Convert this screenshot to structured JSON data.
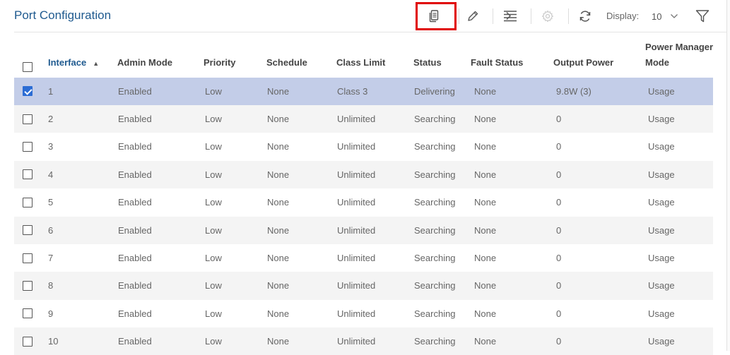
{
  "page": {
    "title": "Port Configuration"
  },
  "toolbar": {
    "display_label": "Display:",
    "display_value": "10",
    "icons": [
      "copy-icon",
      "edit-icon",
      "detail-icon",
      "settings-icon",
      "refresh-icon",
      "filter-icon"
    ],
    "highlight_color": "#e00000"
  },
  "columns": {
    "interface": "Interface",
    "admin_mode": "Admin Mode",
    "priority": "Priority",
    "schedule": "Schedule",
    "class_limit": "Class Limit",
    "status": "Status",
    "fault_status": "Fault Status",
    "output_power": "Output Power",
    "power_mgmt_line1": "Power Manager",
    "power_mgmt_line2": "Mode",
    "sort_indicator": "▲"
  },
  "rows": [
    {
      "selected": true,
      "interface": "1",
      "admin_mode": "Enabled",
      "priority": "Low",
      "schedule": "None",
      "class_limit": "Class 3",
      "status": "Delivering",
      "fault_status": "None",
      "output_power": "9.8W (3)",
      "power_mgmt": "Usage"
    },
    {
      "selected": false,
      "interface": "2",
      "admin_mode": "Enabled",
      "priority": "Low",
      "schedule": "None",
      "class_limit": "Unlimited",
      "status": "Searching",
      "fault_status": "None",
      "output_power": "0",
      "power_mgmt": "Usage"
    },
    {
      "selected": false,
      "interface": "3",
      "admin_mode": "Enabled",
      "priority": "Low",
      "schedule": "None",
      "class_limit": "Unlimited",
      "status": "Searching",
      "fault_status": "None",
      "output_power": "0",
      "power_mgmt": "Usage"
    },
    {
      "selected": false,
      "interface": "4",
      "admin_mode": "Enabled",
      "priority": "Low",
      "schedule": "None",
      "class_limit": "Unlimited",
      "status": "Searching",
      "fault_status": "None",
      "output_power": "0",
      "power_mgmt": "Usage"
    },
    {
      "selected": false,
      "interface": "5",
      "admin_mode": "Enabled",
      "priority": "Low",
      "schedule": "None",
      "class_limit": "Unlimited",
      "status": "Searching",
      "fault_status": "None",
      "output_power": "0",
      "power_mgmt": "Usage"
    },
    {
      "selected": false,
      "interface": "6",
      "admin_mode": "Enabled",
      "priority": "Low",
      "schedule": "None",
      "class_limit": "Unlimited",
      "status": "Searching",
      "fault_status": "None",
      "output_power": "0",
      "power_mgmt": "Usage"
    },
    {
      "selected": false,
      "interface": "7",
      "admin_mode": "Enabled",
      "priority": "Low",
      "schedule": "None",
      "class_limit": "Unlimited",
      "status": "Searching",
      "fault_status": "None",
      "output_power": "0",
      "power_mgmt": "Usage"
    },
    {
      "selected": false,
      "interface": "8",
      "admin_mode": "Enabled",
      "priority": "Low",
      "schedule": "None",
      "class_limit": "Unlimited",
      "status": "Searching",
      "fault_status": "None",
      "output_power": "0",
      "power_mgmt": "Usage"
    },
    {
      "selected": false,
      "interface": "9",
      "admin_mode": "Enabled",
      "priority": "Low",
      "schedule": "None",
      "class_limit": "Unlimited",
      "status": "Searching",
      "fault_status": "None",
      "output_power": "0",
      "power_mgmt": "Usage"
    },
    {
      "selected": false,
      "interface": "10",
      "admin_mode": "Enabled",
      "priority": "Low",
      "schedule": "None",
      "class_limit": "Unlimited",
      "status": "Searching",
      "fault_status": "None",
      "output_power": "0",
      "power_mgmt": "Usage"
    }
  ],
  "colors": {
    "title": "#1f5a8f",
    "selected_row": "#c3cde8",
    "alt_row": "#f4f4f4",
    "checkbox_checked": "#2b6cd4"
  }
}
